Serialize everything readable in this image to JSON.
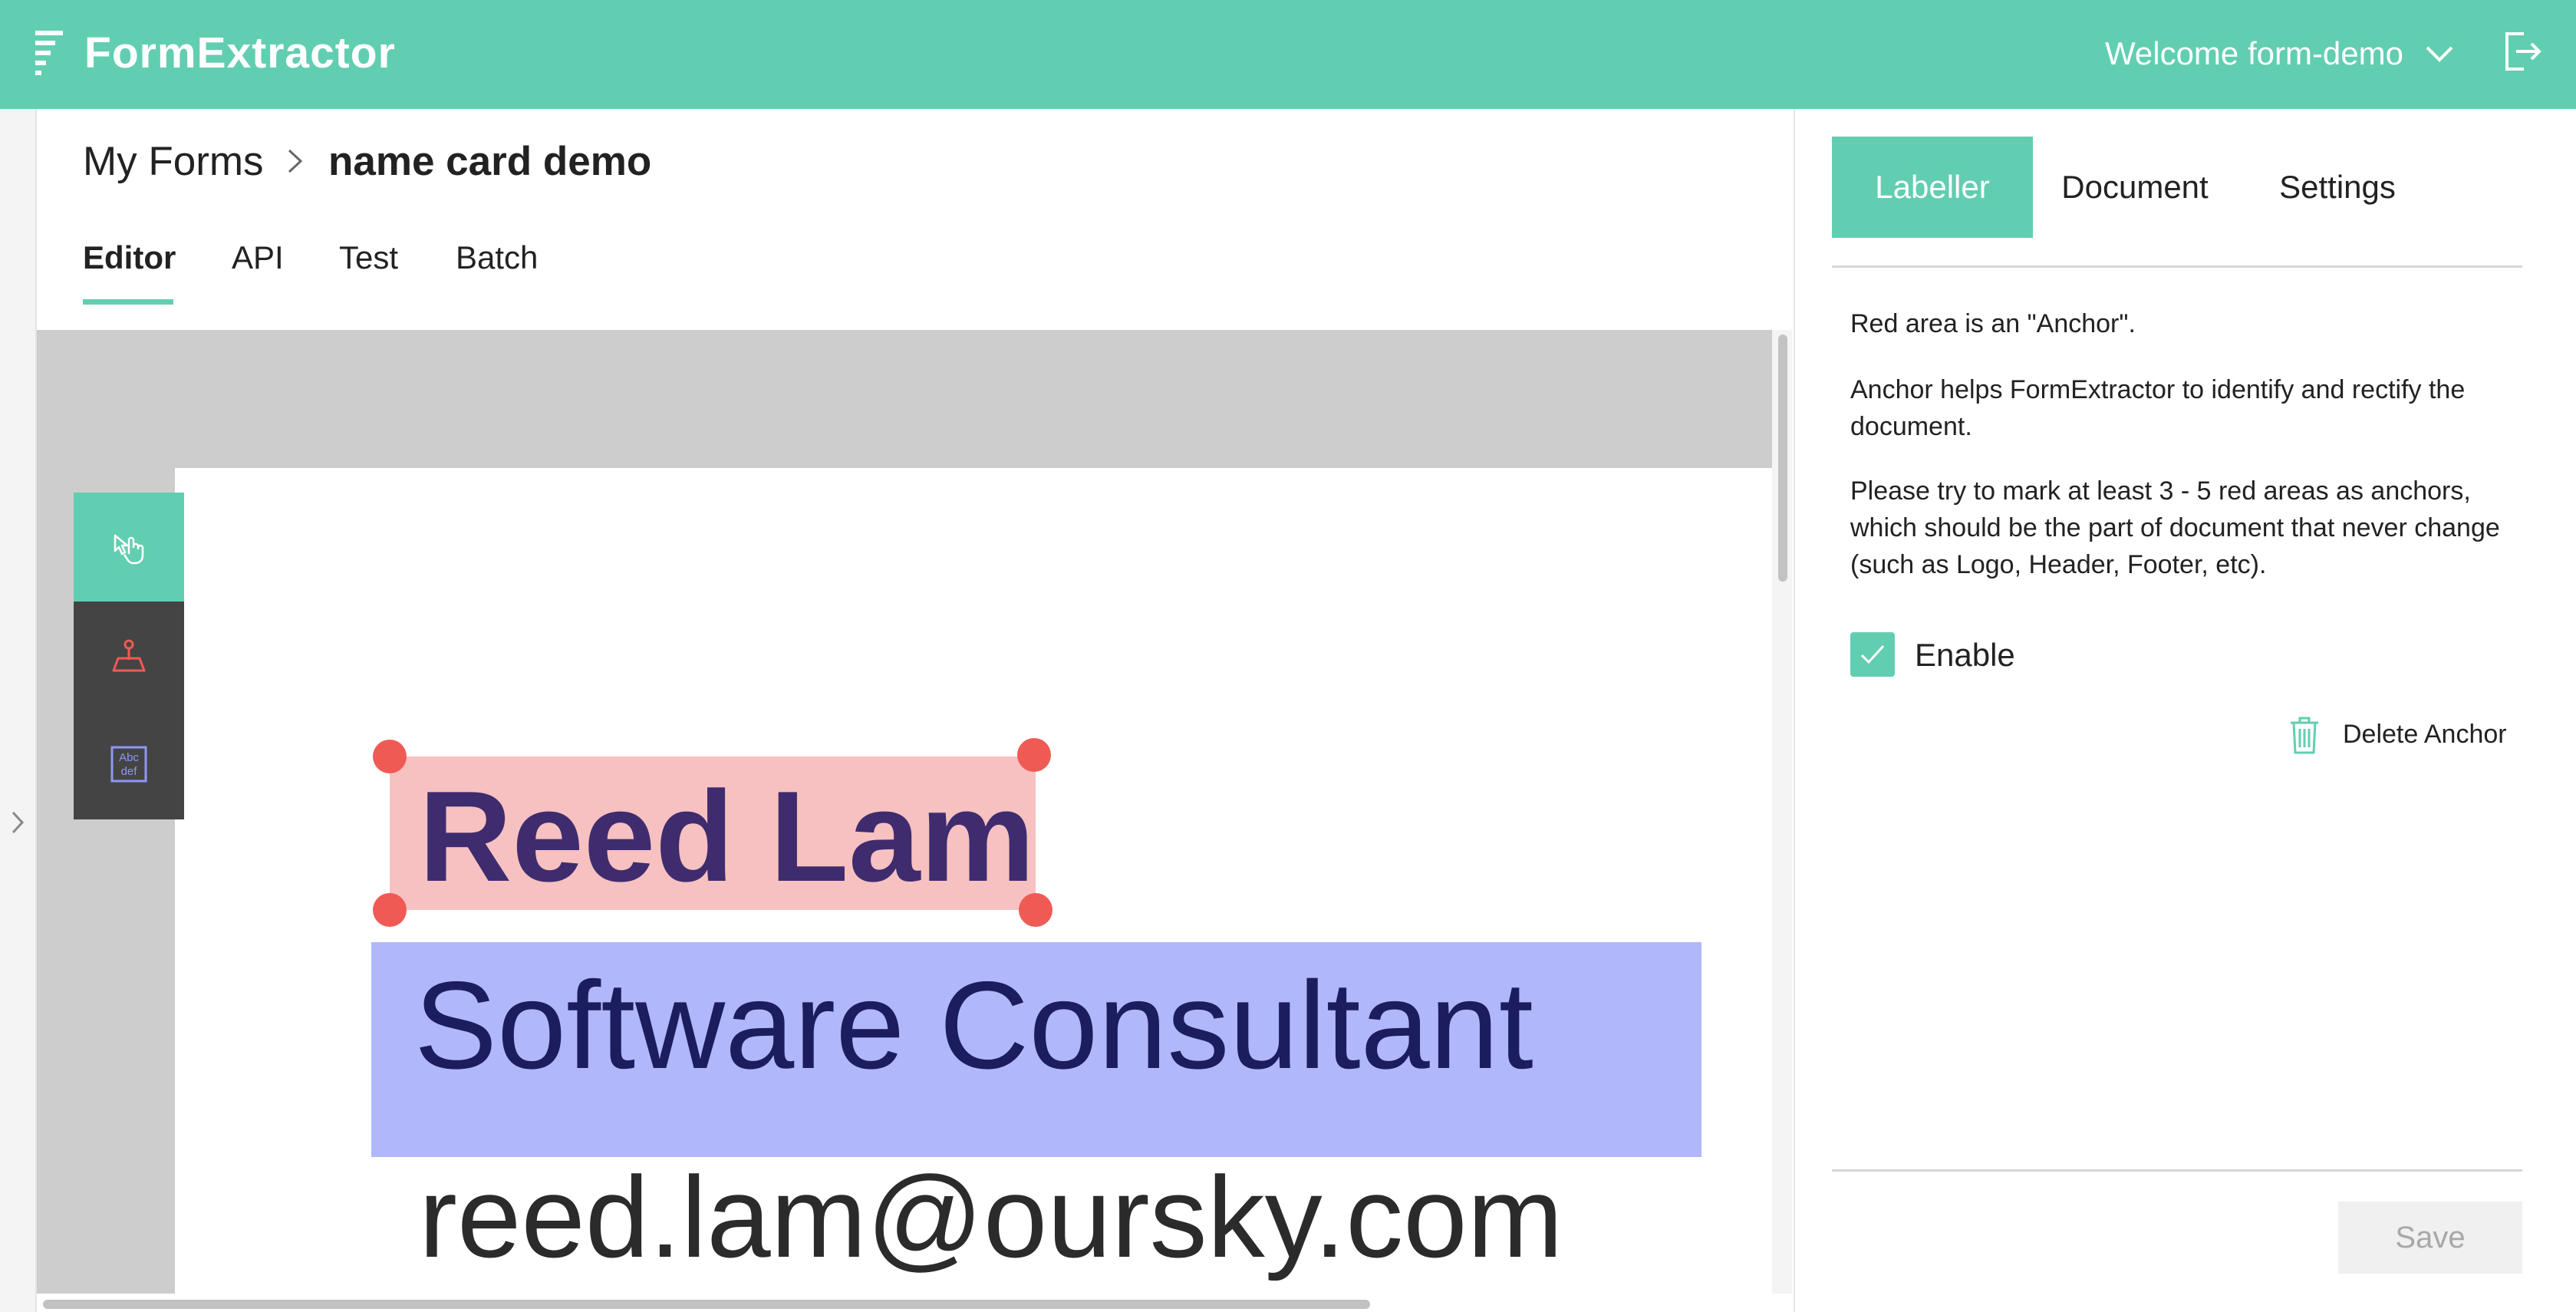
{
  "header": {
    "app_name": "FormExtractor",
    "welcome": "Welcome form-demo",
    "icons": {
      "logo": "formextractor-logo-icon",
      "dropdown": "chevron-down-icon",
      "logout": "logout-icon"
    }
  },
  "breadcrumb": {
    "root": "My Forms",
    "current": "name card demo"
  },
  "tabs": [
    {
      "label": "Editor",
      "active": true
    },
    {
      "label": "API",
      "active": false
    },
    {
      "label": "Test",
      "active": false
    },
    {
      "label": "Batch",
      "active": false
    }
  ],
  "tools": [
    {
      "name": "select-tool",
      "icon": "hand-pointer-icon",
      "selected": true
    },
    {
      "name": "anchor-tool",
      "icon": "anchor-pin-icon",
      "selected": false
    },
    {
      "name": "text-field-tool",
      "icon": "text-abc-def-icon",
      "selected": false
    }
  ],
  "document": {
    "name": "Reed Lam",
    "title": "Software Consultant",
    "email": "reed.lam@oursky.com"
  },
  "right_panel": {
    "tabs": [
      {
        "label": "Labeller",
        "active": true
      },
      {
        "label": "Document",
        "active": false
      },
      {
        "label": "Settings",
        "active": false
      }
    ],
    "paragraphs": [
      "Red area is an \"Anchor\".",
      "Anchor helps FormExtractor to identify and rectify the document.",
      "Please try to mark at least 3 - 5 red areas as anchors, which should be the part of document that never change (such as Logo, Header, Footer, etc)."
    ],
    "enable_label": "Enable",
    "enable_checked": true,
    "delete_label": "Delete Anchor",
    "save_label": "Save"
  },
  "colors": {
    "accent": "#62ceb1",
    "anchor_region": "#f3a0a0",
    "anchor_handle": "#ef5b54",
    "field_region": "#8e98f8",
    "tool_bg": "#444444"
  }
}
